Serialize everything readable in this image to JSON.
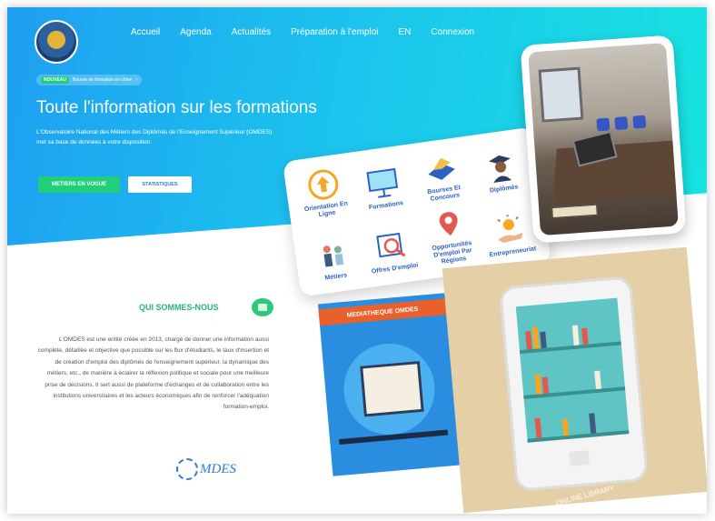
{
  "nav": {
    "items": [
      "Accueil",
      "Agenda",
      "Actualités",
      "Préparation à l'emploi",
      "EN",
      "Connexion"
    ]
  },
  "announcement": {
    "badge": "NOUVEAU",
    "text": "Bourse de formation en chine"
  },
  "hero": {
    "title": "Toute l'information sur les  formations",
    "description": "L'Observatoire National des Métiers des Diplômés de l'Enseignement Supérieur (OMDES) met sa base de données à votre disposition",
    "primary_button": "METIERS EN VOGUE",
    "secondary_button": "STATISTIQUES"
  },
  "categories": [
    {
      "label": "Orientation En Ligne",
      "icon": "arrow-up-icon"
    },
    {
      "label": "Formations",
      "icon": "presentation-board-icon"
    },
    {
      "label": "Bourses Et Concours",
      "icon": "laptop-icon"
    },
    {
      "label": "Diplômés",
      "icon": "graduate-icon"
    },
    {
      "label": "Métiers",
      "icon": "workers-icon"
    },
    {
      "label": "Offres D'emploi",
      "icon": "magnifier-icon"
    },
    {
      "label": "Opportunités D'emploi Par Régions",
      "icon": "map-pin-icon"
    },
    {
      "label": "Entrepreneuriat",
      "icon": "idea-hand-icon"
    }
  ],
  "about": {
    "title": "QUI SOMMES-NOUS",
    "text": "L'OMDES est une entité créée en 2013, chargé de donner une information aussi complète, détaillée et objective que possible sur les flux d'étudiants, le taux d'insertion et de création d'emploi des diplômés de l'enseignement supérieur, la dynamique des métiers, etc., de manière à éclairer la réflexion politique et sociale pour une meilleure prise de décisions. Il sert aussi de plateforme d'échanges et de collaboration entre les institutions universitaires et les acteurs économiques afin de renforcer l'adéquation formation-emploi.",
    "logo_text": "MDES"
  },
  "media": {
    "title": "MEDIATHEQUE OMDES",
    "library_label": "ONLINE LIBRARY"
  },
  "colors": {
    "green": "#1fcf7a",
    "blue": "#2b62c4",
    "hero_start": "#1e9ff0",
    "hero_end": "#18e4e0"
  }
}
